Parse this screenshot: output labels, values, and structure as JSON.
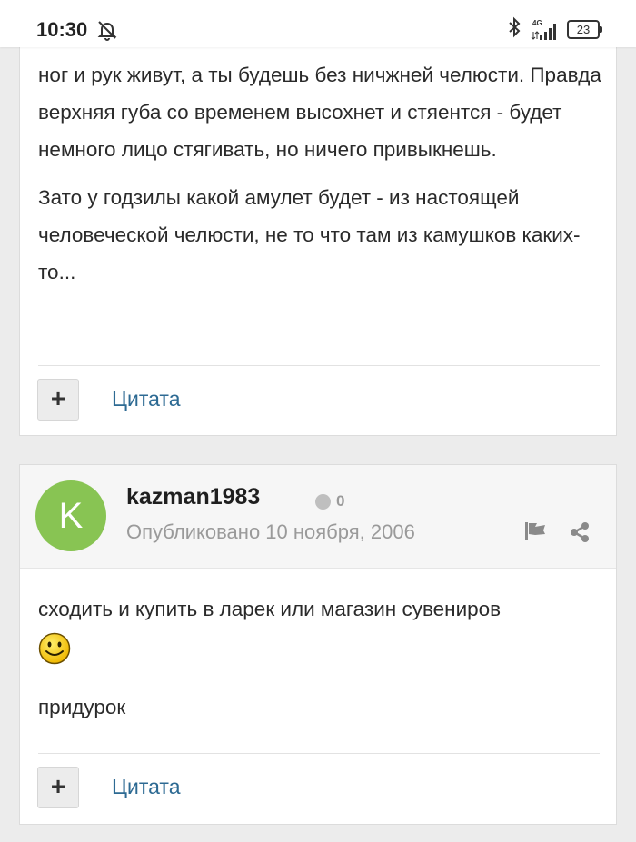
{
  "status_bar": {
    "time": "10:30",
    "network": "4G",
    "battery": "23"
  },
  "post1": {
    "paragraphs": [
      "ног и рук живут, а ты будешь без ничжней челюсти. Правда верхняя губа со временем высохнет и стяентся - будет немного лицо стягивать, но ничего привыкнешь.",
      "Зато у годзилы какой амулет будет - из настоящей человеческой челюсти, не то что там из камушков каких-то..."
    ],
    "plus_label": "+",
    "quote_label": "Цитата"
  },
  "post2": {
    "avatar_letter": "K",
    "avatar_color": "#88c453",
    "username": "kazman1983",
    "reputation": "0",
    "published": "Опубликовано 10 ноября, 2006",
    "paragraphs": [
      "сходить и купить в ларек или магазин сувениров",
      "придурок"
    ],
    "plus_label": "+",
    "quote_label": "Цитата"
  },
  "colors": {
    "link": "#2d6a93",
    "muted": "#9a9a9a",
    "background": "#ececec"
  }
}
